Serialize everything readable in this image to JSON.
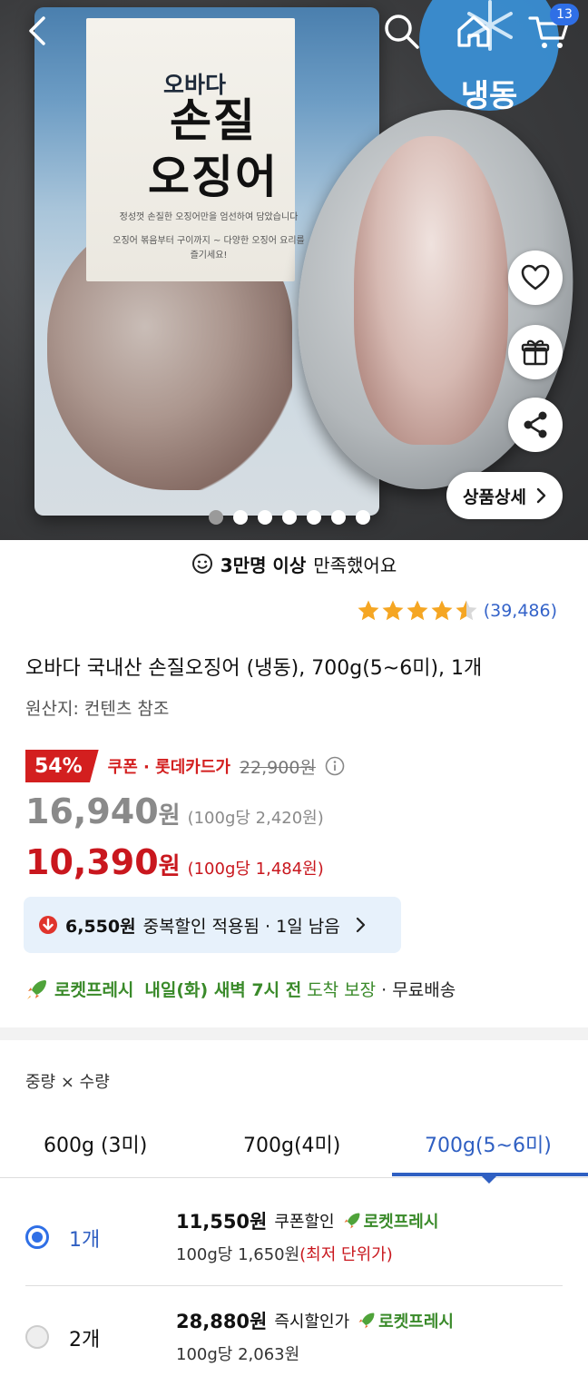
{
  "header": {
    "cart_count": "13",
    "frozen_badge": "냉동"
  },
  "hero": {
    "bag_brand": "오바다",
    "bag_title": "손질\n오징어",
    "bag_small_1": "정성껏 손질한 오징어만을 엄선하여 담았습니다",
    "bag_small_2": "오징어 볶음부터 구이까지 ~ 다양한 오징어 요리를 즐기세요!",
    "detail_button": "상품상세",
    "image_count": 7,
    "active_image_index": 0
  },
  "satisfaction": {
    "bold": "3만명 이상",
    "rest": "만족했어요"
  },
  "rating": {
    "stars": 4.5,
    "review_count": "(39,486)"
  },
  "product": {
    "title": "오바다 국내산 손질오징어 (냉동), 700g(5~6미), 1개",
    "origin": "원산지: 컨텐츠 참조"
  },
  "pricing": {
    "discount_pct": "54%",
    "coupon_label": "쿠폰 · 롯데카드가",
    "original_price": "22,900원",
    "sale_price": "16,940",
    "sale_price_unit": "원",
    "sale_unit_price": "(100g당 2,420원)",
    "final_price": "10,390",
    "final_price_unit": "원",
    "final_unit_price": "(100g당 1,484원)",
    "colors": {
      "red": "#c9171e",
      "gray": "#8a8a8a"
    }
  },
  "dup_discount": {
    "amount": "6,550원",
    "text": "중복할인 적용됨 · 1일 남음"
  },
  "delivery": {
    "rocket": "로켓프레시",
    "arrival": "내일(화) 새벽 7시 전",
    "guarantee": "도착 보장",
    "shipping": "· 무료배송"
  },
  "options": {
    "label": "중량 × 수량",
    "tabs": [
      {
        "label": "600g (3미)"
      },
      {
        "label": "700g(4미)"
      },
      {
        "label": "700g(5~6미)"
      }
    ],
    "active_tab": 2,
    "rows": [
      {
        "qty": "1개",
        "price": "11,550원",
        "tag": "쿠폰할인",
        "rocket": "로켓프레시",
        "unit": "100g당 1,650원",
        "note": "(최저 단위가)",
        "selected": true
      },
      {
        "qty": "2개",
        "price": "28,880원",
        "tag": "즉시할인가",
        "rocket": "로켓프레시",
        "unit": "100g당 2,063원",
        "note": "",
        "selected": false
      }
    ]
  },
  "brand_colors": {
    "blue": "#2f6fe6",
    "link_blue": "#3463c9",
    "green": "#3a8a2a"
  }
}
